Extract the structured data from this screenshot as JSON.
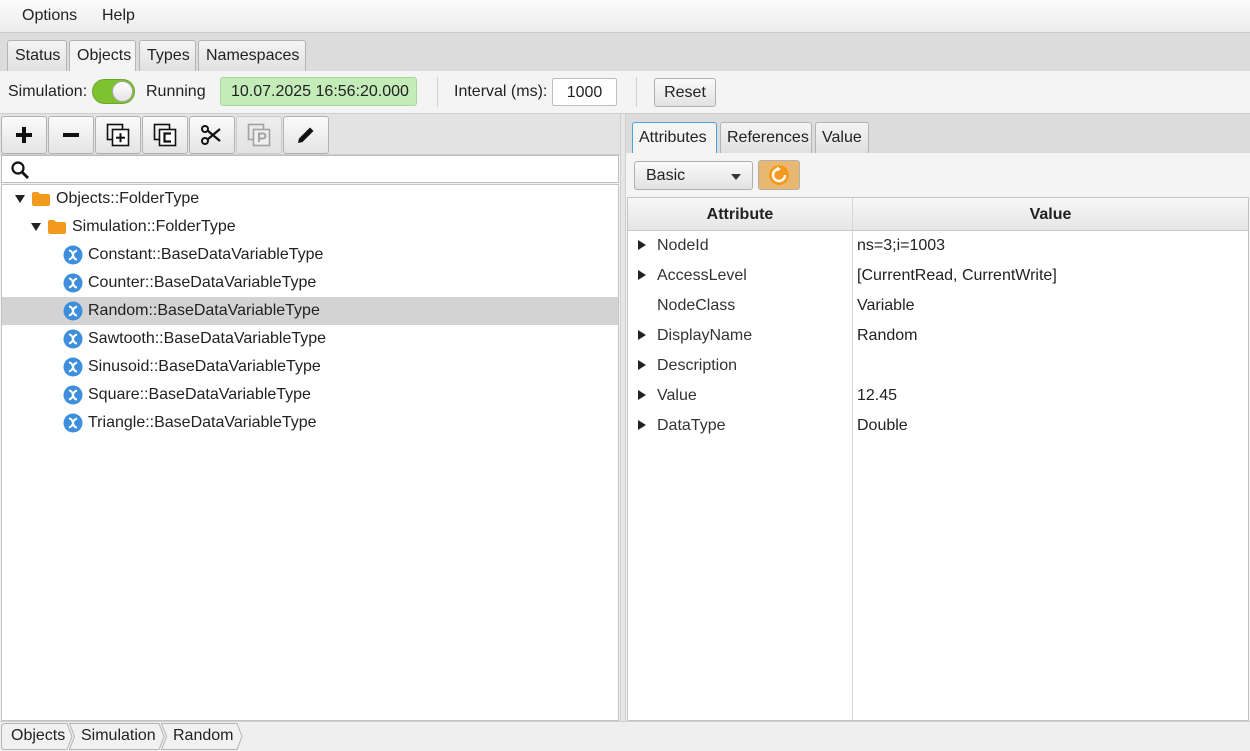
{
  "menu": {
    "options": "Options",
    "help": "Help"
  },
  "tabs": {
    "status": "Status",
    "objects": "Objects",
    "types": "Types",
    "namespaces": "Namespaces"
  },
  "simulation": {
    "label": "Simulation:",
    "state": "Running",
    "time": "10.07.2025 16:56:20.000",
    "interval_label": "Interval (ms):",
    "interval_value": "1000",
    "reset": "Reset",
    "toggle_on": true,
    "accent_color": "#7ec232"
  },
  "toolbar": {
    "icons": [
      "plus-icon",
      "minus-icon",
      "copy-icon",
      "copy-c-icon",
      "cut-icon",
      "paste-icon",
      "edit-icon"
    ]
  },
  "search": {
    "placeholder": ""
  },
  "tree": {
    "root": "Objects::FolderType",
    "folder": "Simulation::FolderType",
    "items": [
      "Constant::BaseDataVariableType",
      "Counter::BaseDataVariableType",
      "Random::BaseDataVariableType",
      "Sawtooth::BaseDataVariableType",
      "Sinusoid::BaseDataVariableType",
      "Square::BaseDataVariableType",
      "Triangle::BaseDataVariableType"
    ],
    "selected": "Random::BaseDataVariableType"
  },
  "right_tabs": {
    "attributes": "Attributes",
    "references": "References",
    "value": "Value"
  },
  "attributes": {
    "mode": "Basic",
    "col_attribute": "Attribute",
    "col_value": "Value",
    "rows": [
      {
        "name": "NodeId",
        "value": "ns=3;i=1003",
        "expandable": true
      },
      {
        "name": "AccessLevel",
        "value": "[CurrentRead, CurrentWrite]",
        "expandable": true
      },
      {
        "name": "NodeClass",
        "value": "Variable",
        "expandable": false
      },
      {
        "name": "DisplayName",
        "value": "Random",
        "expandable": true
      },
      {
        "name": "Description",
        "value": "",
        "expandable": true
      },
      {
        "name": "Value",
        "value": "12.45",
        "expandable": true
      },
      {
        "name": "DataType",
        "value": "Double",
        "expandable": true
      }
    ]
  },
  "breadcrumb": [
    "Objects",
    "Simulation",
    "Random"
  ]
}
